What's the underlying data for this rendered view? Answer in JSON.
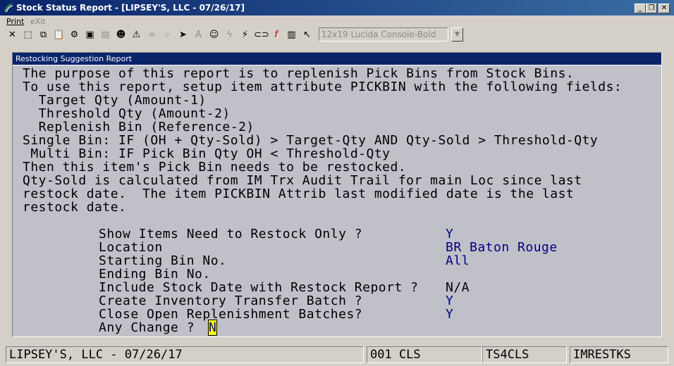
{
  "window": {
    "title": "Stock Status Report - [LIPSEY'S, LLC - 07/26/17]",
    "controls": {
      "minimize": "_",
      "restore": "❐",
      "close": "✕"
    }
  },
  "menu": {
    "print": "Print",
    "exit": "eXit"
  },
  "toolbar": {
    "font_selector": "12x19 Lucida Console-Bold",
    "icons": [
      "close-icon",
      "select-icon",
      "copy-icon",
      "paste-icon",
      "settings-icon",
      "window-icon",
      "notes-icon",
      "users-icon",
      "alert-icon",
      "binoculars-icon",
      "magnify-icon",
      "run-icon",
      "font-icon",
      "user-info-icon",
      "lightning-icon",
      "calc-icon",
      "link-icon",
      "function-icon",
      "book-icon",
      "help-pointer-icon"
    ]
  },
  "screen": {
    "header": "Restocking Suggestion Report",
    "description": [
      "The purpose of this report is to replenish Pick Bins from Stock Bins.",
      "To use this report, setup item attribute PICKBIN with the following fields:",
      "  Target Qty (Amount-1)",
      "  Threshold Qty (Amount-2)",
      "  Replenish Bin (Reference-2)",
      "Single Bin: IF (OH + Qty-Sold) > Target-Qty AND Qty-Sold > Threshold-Qty",
      " Multi Bin: IF Pick Bin Qty OH < Threshold-Qty",
      "Then this item's Pick Bin needs to be restocked.",
      "Qty-Sold is calculated from IM Trx Audit Trail for main Loc since last",
      "restock date.  The item PICKBIN Attrib last modified date is the last",
      "restock date."
    ],
    "fields": [
      {
        "label": "Show Items Need to Restock Only ?",
        "value": "Y"
      },
      {
        "label": "Location",
        "value": "BR Baton Rouge"
      },
      {
        "label": "Starting Bin No.",
        "value": "All"
      },
      {
        "label": "Ending Bin No.",
        "value": ""
      },
      {
        "label": "Include Stock Date with Restock Report ?",
        "value": "N/A"
      },
      {
        "label": "Create Inventory Transfer Batch ?",
        "value": "Y"
      },
      {
        "label": "Close Open Replenishment Batches?",
        "value": "Y"
      }
    ],
    "prompt": {
      "label": "Any Change ?",
      "value": "N"
    }
  },
  "statusbar": {
    "company": "LIPSEY'S, LLC - 07/26/17",
    "user": "001 CLS",
    "terminal": "TS4CLS",
    "program": "IMRESTKS"
  },
  "colors": {
    "title_bar": "#0a246a",
    "screen_bg": "#c0c0c8",
    "value_text": "#000080",
    "cursor": "#ffff00"
  }
}
